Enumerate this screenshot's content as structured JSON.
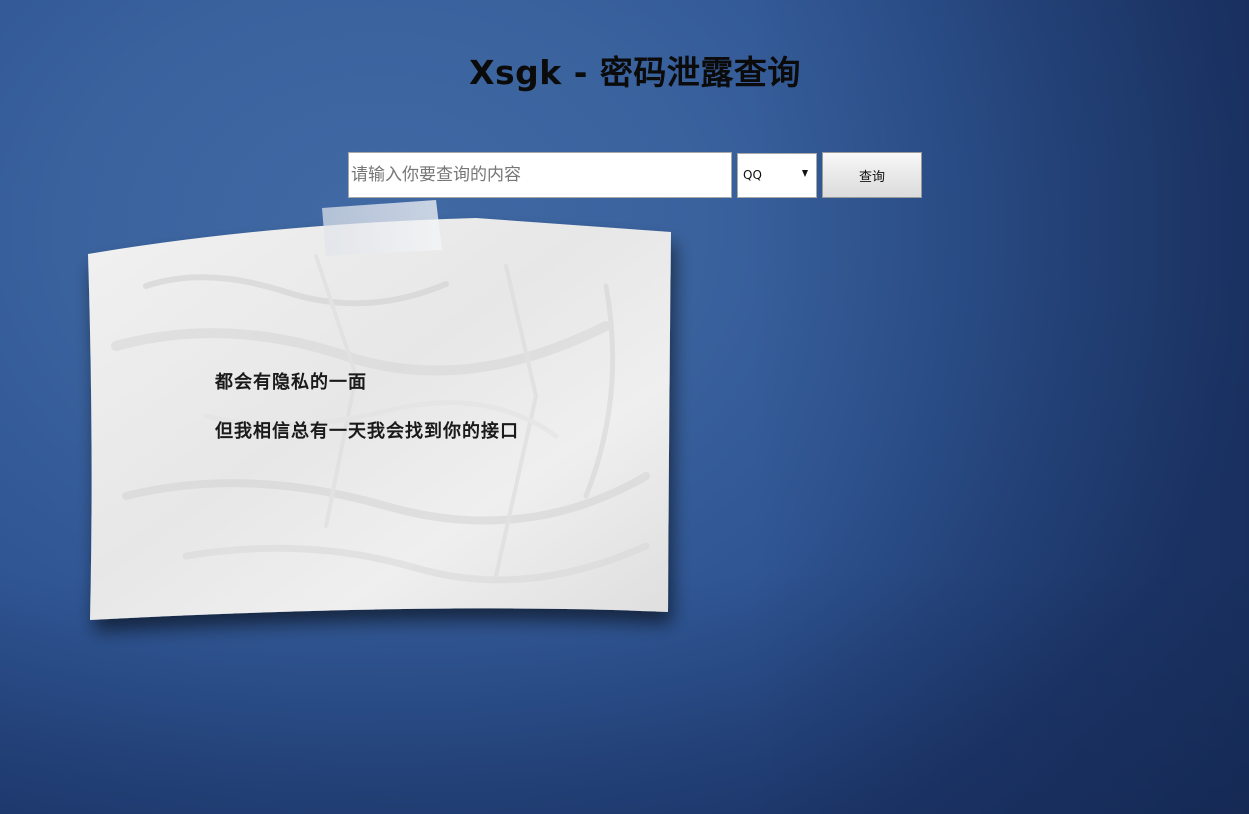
{
  "page": {
    "title": "Xsgk - 密码泄露查询"
  },
  "search": {
    "placeholder": "请输入你要查询的内容",
    "value": "",
    "type_selected": "QQ",
    "button_label": "查询"
  },
  "note": {
    "lines": [
      "都会有隐私的一面",
      "但我相信总有一天我会找到你的接口"
    ]
  },
  "colors": {
    "background": "#3a629d",
    "paper": "#eeeeee",
    "title_text": "#0b0b0b"
  },
  "icons": {
    "select_arrow": "triangle-down"
  }
}
